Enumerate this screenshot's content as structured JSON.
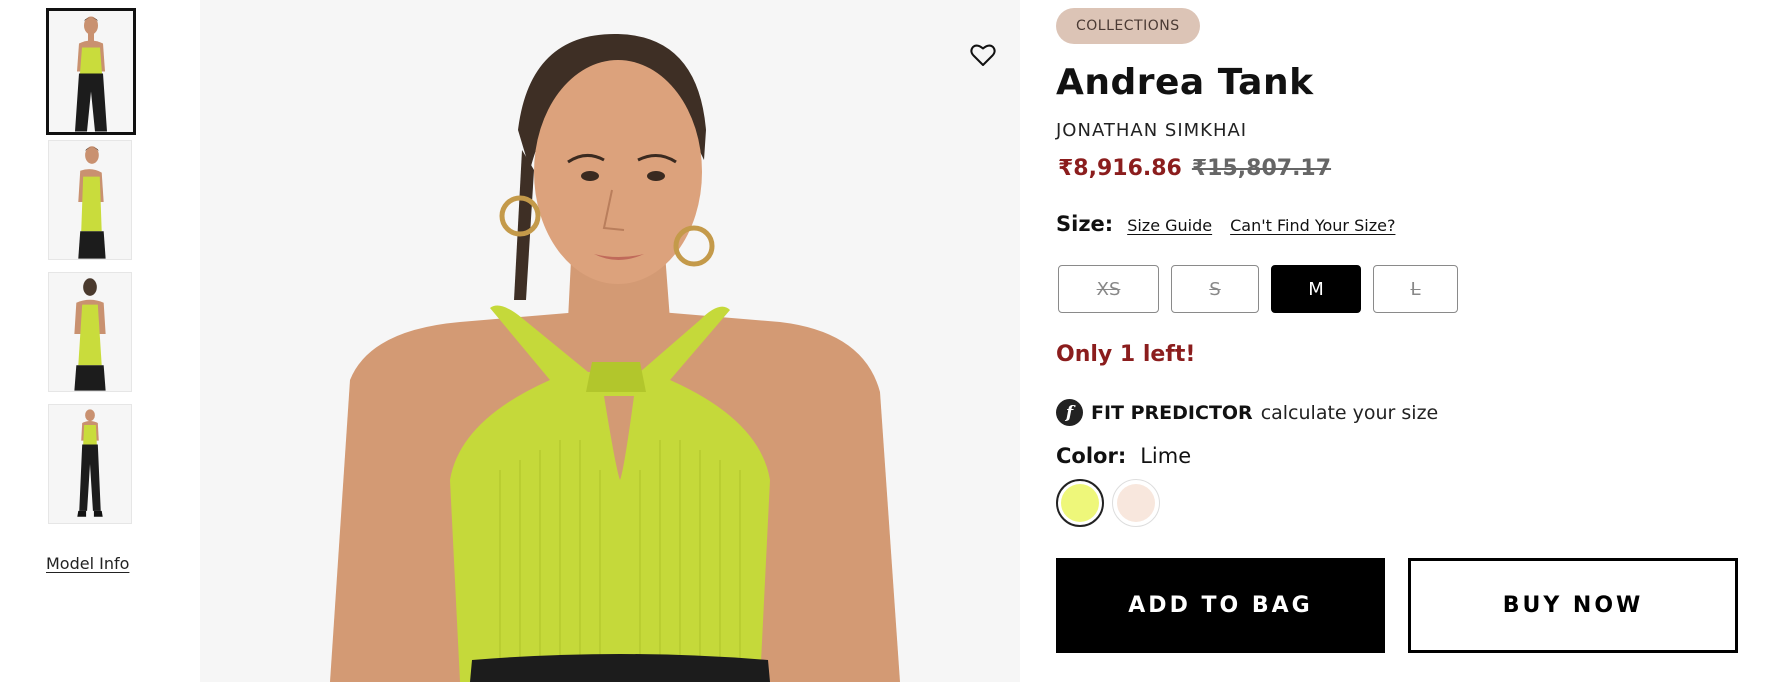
{
  "gallery": {
    "thumbnails": [
      {
        "alt": "front view",
        "active": true
      },
      {
        "alt": "side view",
        "active": false
      },
      {
        "alt": "back view",
        "active": false
      },
      {
        "alt": "full length view",
        "active": false
      }
    ],
    "model_info_label": "Model Info",
    "wishlist_icon": "heart-outline-icon"
  },
  "product": {
    "badge": "COLLECTIONS",
    "title": "Andrea Tank",
    "brand": "JONATHAN SIMKHAI",
    "sale_price": "₹8,916.86",
    "original_price": "₹15,807.17"
  },
  "size": {
    "label": "Size:",
    "guide_link": "Size Guide",
    "cant_find_link": "Can't Find Your Size?",
    "options": [
      {
        "label": "XS",
        "state": "disabled"
      },
      {
        "label": "S",
        "state": "disabled"
      },
      {
        "label": "M",
        "state": "selected"
      },
      {
        "label": "L",
        "state": "disabled"
      }
    ]
  },
  "stock_message": "Only 1 left!",
  "fit_predictor": {
    "logo_glyph": "f",
    "title": "FIT PREDICTOR",
    "subtitle": "calculate your size"
  },
  "color": {
    "label": "Color:",
    "value": "Lime",
    "swatches": [
      {
        "name": "Lime",
        "hex": "#eef77a",
        "selected": true
      },
      {
        "name": "Peach",
        "hex": "#f8e7dd",
        "selected": false
      }
    ]
  },
  "actions": {
    "add_to_bag": "ADD TO BAG",
    "buy_now": "BUY NOW"
  },
  "colors": {
    "sale_price": "#8b1d1d",
    "badge_bg": "#dcc4b6",
    "primary_button": "#000000"
  }
}
